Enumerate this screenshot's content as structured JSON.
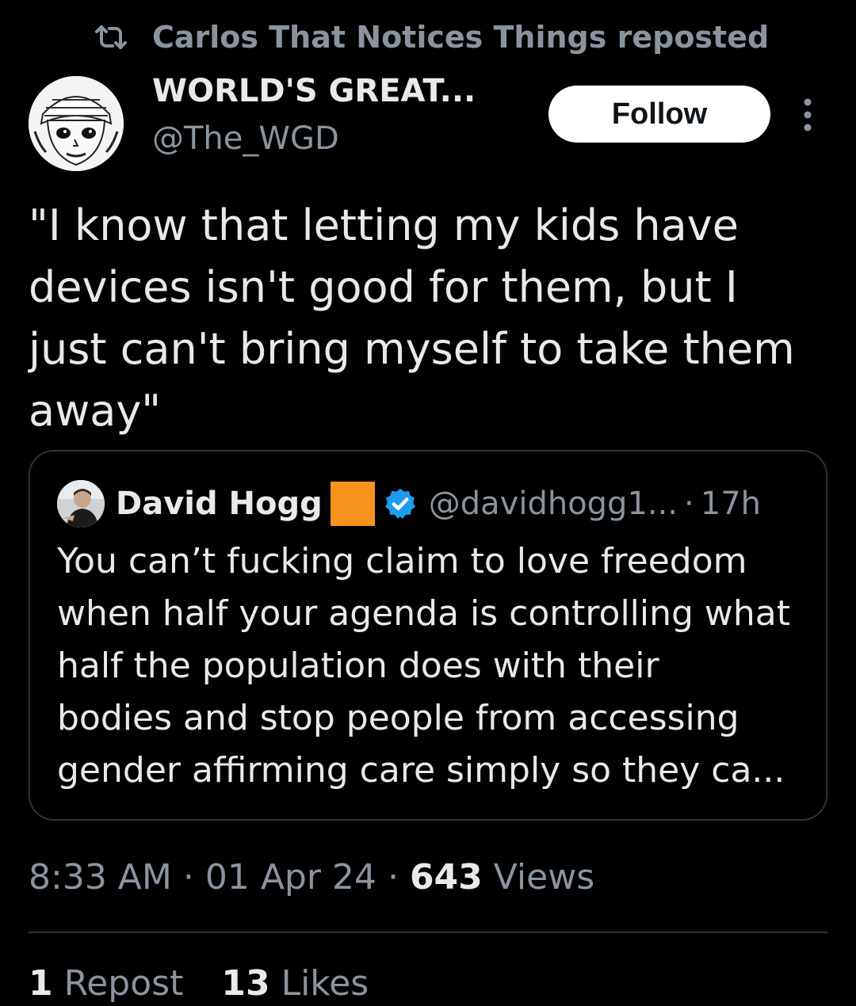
{
  "repost_banner": {
    "icon": "repost-icon",
    "text": "Carlos That Notices Things reposted"
  },
  "author": {
    "avatar": "manga-avatar",
    "name": "WORLD'S GREAT...",
    "handle": "@The_WGD"
  },
  "actions": {
    "follow_label": "Follow",
    "more_icon": "more-vertical-icon"
  },
  "post": {
    "text": "\"I know that letting my kids have\ndevices isn't good for them, but I\njust can't bring myself to take them\naway\""
  },
  "quote": {
    "avatar": "david-hogg-avatar",
    "name": "David Hogg",
    "flag_color": "#F7931E",
    "verified_icon": "verified-badge-icon",
    "verified_color": "#1D9BF0",
    "handle": "@davidhogg1...",
    "separator": "·",
    "time": "17h",
    "text": "You can’t fucking claim to love freedom\nwhen half your agenda is controlling what\nhalf the population does with their\nbodies and stop people from accessing\ngender affirming care simply so they ca..."
  },
  "meta": {
    "time": "8:33 AM",
    "separator": "·",
    "date": "01 Apr 24",
    "views_count": "643",
    "views_label": "Views"
  },
  "stats": {
    "reposts_count": "1",
    "reposts_label": "Repost",
    "likes_count": "13",
    "likes_label": "Likes"
  },
  "colors": {
    "background": "#000000",
    "text_primary": "#E7E9EA",
    "text_secondary": "#8B949E",
    "border": "#2F3336"
  }
}
